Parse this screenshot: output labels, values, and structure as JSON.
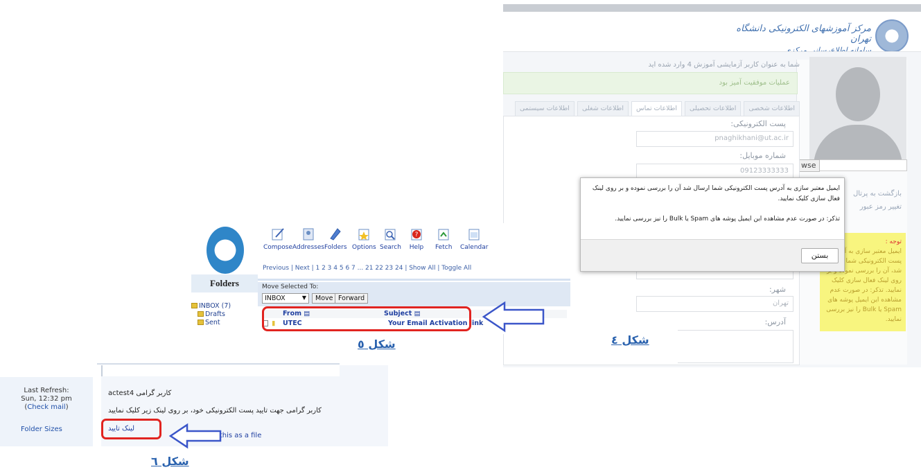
{
  "fig4": {
    "header": {
      "logo_line1": "مرکز آموزشهای الکترونیکی دانشگاه تهران",
      "logo_line2": "سامانه اطلاع‌رسانی مرکزی"
    },
    "welcome": "شما به عنوان کاربر آزمایشی آموزش 4 وارد شده اید",
    "success_message": "عملیات موفقیت آمیز بود",
    "tabs": [
      "اطلاعات شخصی",
      "اطلاعات تحصیلی",
      "اطلاعات تماس",
      "اطلاعات شغلی",
      "اطلاعات سیستمی"
    ],
    "form": {
      "email_label": "پست الکترونیکی:",
      "email_value": "pnaghikhani@ut.ac.ir",
      "mobile_label": "شماره موبایل:",
      "mobile_value": "09123333333",
      "city_label": "شهر:",
      "city_value": "تهران",
      "address_label": "آدرس:"
    },
    "browse_label": "wse",
    "sidebar_links": [
      "بازگشت به پرتال",
      "تغییر رمز عبور"
    ],
    "note": {
      "title": "توجه :",
      "body": "ایمیل معتبر سازی به آدرس پست الکترونیکی شما ارسال شد، آن را بررسی نموده و بر روی لینک فعال سازی کلیک نمایید. تذکر: در صورت عدم مشاهده این ایمیل پوشه های Spam یا Bulk را نیز بررسی نمایید."
    },
    "dialog": {
      "message": "ایمیل معتبر سازی به آدرس پست الکترونیکی شما ارسال شد آن را بررسی نموده و بر روی لینک فعال سازی کلیک نمایید.",
      "reminder": "تذکر: در صورت عدم مشاهده این ایمیل پوشه های Spam یا Bulk را نیز بررسی نمایید.",
      "close_label": "بستن"
    },
    "caption": "شکل ٤"
  },
  "fig5": {
    "toolbar": [
      "Compose",
      "Addresses",
      "Folders",
      "Options",
      "Search",
      "Help",
      "Fetch",
      "Calendar"
    ],
    "pagination": "Previous | Next | 1 2 3 4 5 6 7 ... 21 22 23 24 | Show All | Toggle All",
    "folders_title": "Folders",
    "folders": [
      "INBOX (7)",
      "Drafts",
      "Sent"
    ],
    "move_label": "Move Selected To:",
    "move_select": "INBOX",
    "move_button": "Move",
    "forward_button": "Forward",
    "columns": {
      "from": "From",
      "subject": "Subject"
    },
    "message": {
      "from": "UTEC",
      "subject": "Your Email Activation link"
    },
    "caption": "شکل ٥"
  },
  "fig6": {
    "last_refresh_label": "Last Refresh:",
    "last_refresh_time": "Sun, 12:32 pm",
    "check_mail": "Check mail",
    "folder_sizes": "Folder Sizes",
    "greeting": "کاربر گرامی actest4",
    "body": "کاربر گرامی جهت تایید پست الکترونیکی خود، بر روی لینک زیر کلیک نمایید",
    "confirm_link": "لینک تایید",
    "download": "Download this as a file",
    "caption": "شکل ٦"
  },
  "colors": {
    "caption": "#2a62ae",
    "highlight": "#e12420",
    "arrow": "#3b56c9",
    "note_bg": "#f8f57f"
  }
}
